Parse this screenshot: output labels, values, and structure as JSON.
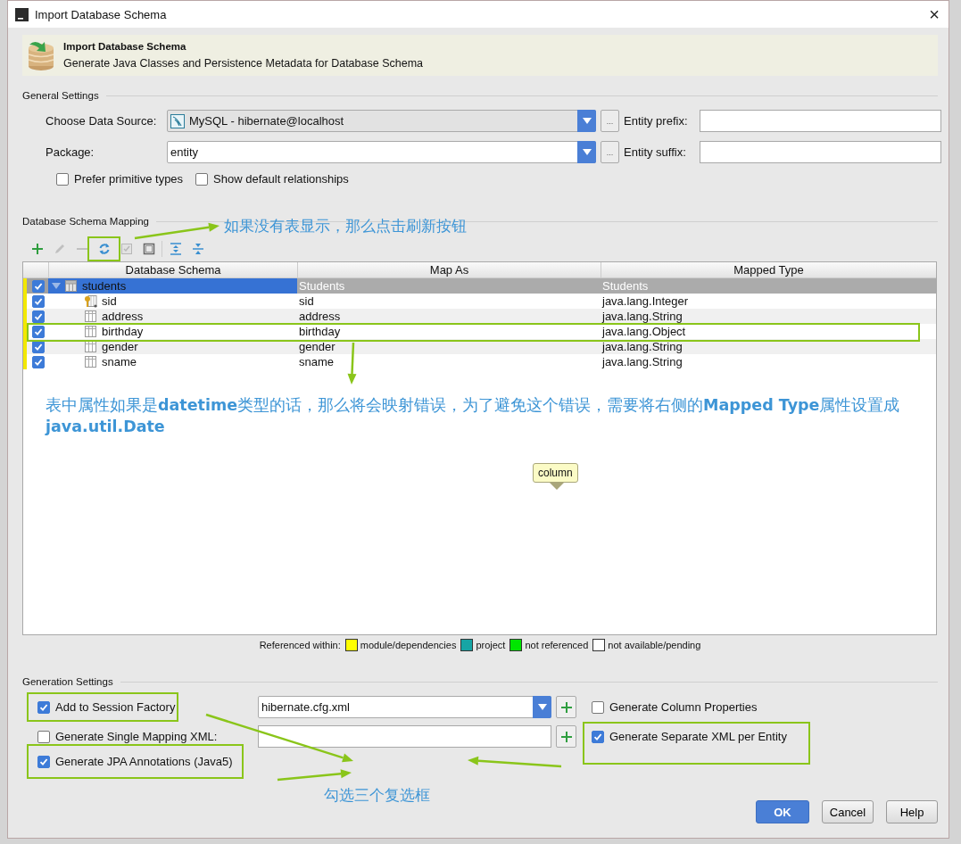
{
  "window": {
    "title": "Import Database Schema",
    "close": "×"
  },
  "header": {
    "title": "Import Database Schema",
    "subtitle": "Generate Java Classes and Persistence Metadata for Database Schema"
  },
  "general_settings": {
    "title": "General Settings",
    "data_source": {
      "label": "Choose Data Source:",
      "value": "MySQL - hibernate@localhost",
      "browse": "..."
    },
    "package": {
      "label": "Package:",
      "value": "entity",
      "browse": "..."
    },
    "entity_prefix": {
      "label": "Entity prefix:"
    },
    "entity_suffix": {
      "label": "Entity suffix:"
    },
    "options": [
      {
        "label": "Prefer primitive types",
        "checked": false
      },
      {
        "label": "Show default relationships",
        "checked": false
      }
    ]
  },
  "mapping": {
    "title": "Database Schema Mapping",
    "toolbar": [
      {
        "kind": "add",
        "disabled": false
      },
      {
        "kind": "edit",
        "disabled": true
      },
      {
        "kind": "remove",
        "disabled": true
      },
      {
        "kind": "refresh",
        "disabled": false
      },
      {
        "kind": "check-all",
        "disabled": true
      },
      {
        "kind": "uncheck-all",
        "disabled": false
      },
      {
        "kind": "expand-all",
        "disabled": false
      },
      {
        "kind": "collapse-all",
        "disabled": false
      }
    ],
    "table": {
      "columns": [
        "Database Schema",
        "Map As",
        "Mapped Type"
      ],
      "rows": [
        {
          "kind": "table",
          "name": "students",
          "map_as": "Students",
          "mapped_type": "Students",
          "checked": true,
          "selected": true,
          "expanded": true,
          "children": [
            {
              "kind": "key",
              "name": "sid",
              "map_as": "sid",
              "mapped_type": "java.lang.Integer",
              "checked": true,
              "selected": false
            },
            {
              "kind": "column",
              "name": "address",
              "map_as": "address",
              "mapped_type": "java.lang.String",
              "checked": true,
              "selected": false
            },
            {
              "kind": "column",
              "name": "birthday",
              "map_as": "birthday",
              "mapped_type": "java.lang.Object",
              "checked": true,
              "selected": false
            },
            {
              "kind": "column",
              "name": "gender",
              "map_as": "gender",
              "mapped_type": "java.lang.String",
              "checked": true,
              "selected": false
            },
            {
              "kind": "column",
              "name": "sname",
              "map_as": "sname",
              "mapped_type": "java.lang.String",
              "checked": true,
              "selected": false
            }
          ]
        }
      ]
    },
    "tooltip": "column",
    "legend": {
      "label": "Referenced within:",
      "items": [
        {
          "label": "module/dependencies",
          "color": "#ffff00"
        },
        {
          "label": "project",
          "color": "#17a5a5"
        },
        {
          "label": "not referenced",
          "color": "#00e600"
        },
        {
          "label": "not available/pending",
          "color": "#ffffff"
        }
      ]
    }
  },
  "generation_settings": {
    "title": "Generation Settings",
    "session_factory": {
      "label": "Add to Session Factory",
      "checked": true,
      "value": "hibernate.cfg.xml"
    },
    "single_mapping": {
      "label": "Generate Single Mapping XML:",
      "checked": false
    },
    "jpa_annotations": {
      "label": "Generate JPA Annotations (Java5)",
      "checked": true
    },
    "column_properties": {
      "label": "Generate Column Properties",
      "checked": false
    },
    "separate_xml": {
      "label": "Generate Separate XML per Entity",
      "checked": true
    }
  },
  "buttons": [
    {
      "label": "OK",
      "kind": "primary"
    },
    {
      "label": "Cancel",
      "kind": "normal"
    },
    {
      "label": "Help",
      "kind": "normal"
    }
  ],
  "annotations": [
    {
      "kind": "note",
      "text": "如果没有表显示，那么点击刷新按钮"
    },
    {
      "kind": "paragraph",
      "text": "表中属性如果是**datetime**类型的话，那么将会映射错误，为了避免这个错误，需要将右侧的**Mapped Type**属性设置成**java.util.Date**"
    },
    {
      "kind": "note",
      "text": "勾选三个复选框"
    }
  ]
}
